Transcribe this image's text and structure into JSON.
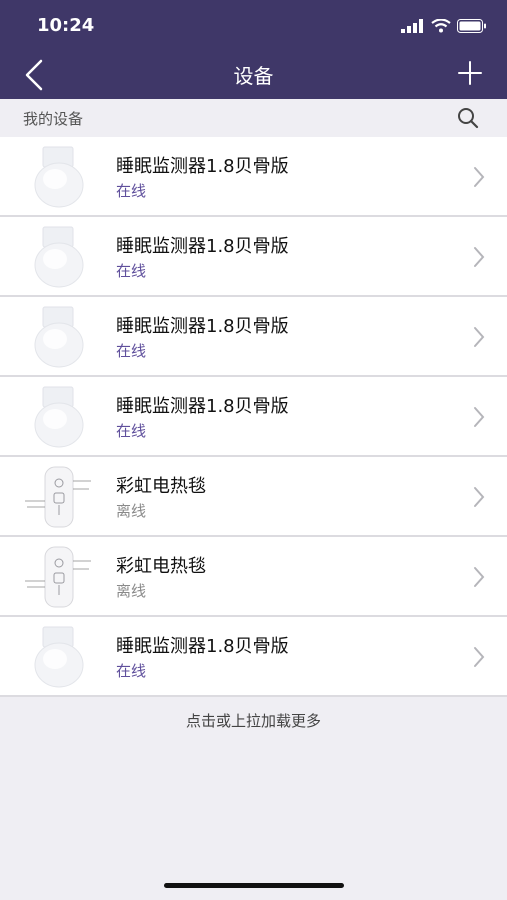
{
  "status_bar": {
    "time": "10:24"
  },
  "nav": {
    "title": "设备"
  },
  "section": {
    "label": "我的设备"
  },
  "devices": [
    {
      "name": "睡眠监测器1.8贝骨版",
      "status": "在线",
      "online": true,
      "thumb": "sleep-monitor-image"
    },
    {
      "name": "睡眠监测器1.8贝骨版",
      "status": "在线",
      "online": true,
      "thumb": "sleep-monitor-image"
    },
    {
      "name": "睡眠监测器1.8贝骨版",
      "status": "在线",
      "online": true,
      "thumb": "sleep-monitor-image"
    },
    {
      "name": "睡眠监测器1.8贝骨版",
      "status": "在线",
      "online": true,
      "thumb": "sleep-monitor-image"
    },
    {
      "name": "彩虹电热毯",
      "status": "离线",
      "online": false,
      "thumb": "blanket-remote-image"
    },
    {
      "name": "彩虹电热毯",
      "status": "离线",
      "online": false,
      "thumb": "blanket-remote-image"
    },
    {
      "name": "睡眠监测器1.8贝骨版",
      "status": "在线",
      "online": true,
      "thumb": "sleep-monitor-image"
    }
  ],
  "footer": {
    "load_more": "点击或上拉加载更多"
  },
  "colors": {
    "header_bg": "#3f3768",
    "online": "#5f4f9c",
    "offline": "#8a8a8a",
    "page_bg": "#efeef3"
  }
}
